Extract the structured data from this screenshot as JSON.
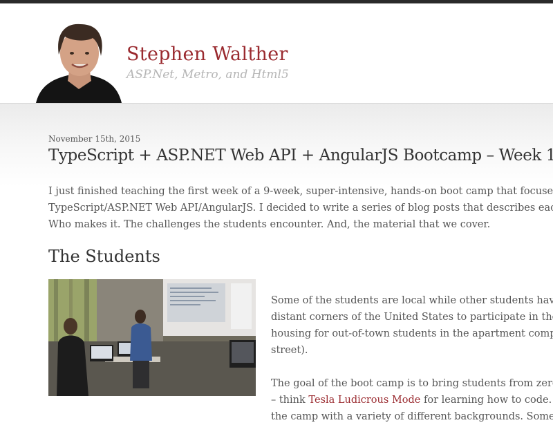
{
  "site": {
    "title": "Stephen Walther",
    "tagline": "ASP.Net, Metro, and Html5"
  },
  "post": {
    "date": "November 15th, 2015",
    "title": "TypeScript + ASP.NET Web API + AngularJS Bootcamp – Week 1",
    "intro_lines": [
      "I just finished teaching the first week of a 9-week, super-intensive, hands-on boot camp that focuses on",
      "TypeScript/ASP.NET Web API/AngularJS. I decided to write a series of blog posts that describes each w",
      "Who makes it. The challenges the students encounter. And, the material that we cover."
    ],
    "section_heading": "The Students",
    "paragraph1_lines": [
      "Some of the students are local while other students have tr",
      "distant corners of the United States to participate in the ca",
      "housing for out-of-town students in the apartment comple",
      "street)."
    ],
    "paragraph2_line1": "The goal of the boot camp is to bring students from zero to",
    "paragraph2_line2_prefix": "– think ",
    "paragraph2_link": "Tesla Ludicrous Mode",
    "paragraph2_line2_suffix": " for learning how to code. St",
    "paragraph2_line3": "the camp with a variety of different backgrounds. Some stu"
  },
  "colors": {
    "brand": "#9a2a2f",
    "tagline": "#b5b5b5",
    "text": "#555555"
  }
}
